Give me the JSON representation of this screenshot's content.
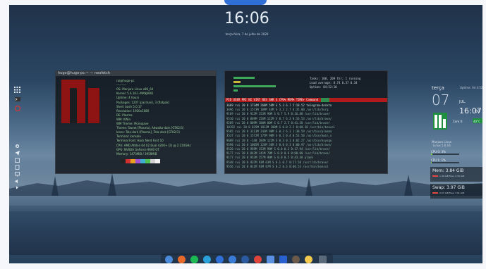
{
  "desktop": {
    "clock_time": "16:06",
    "clock_date": "terça-feira, 7 de julho de 2020"
  },
  "colors": {
    "accent_green": "#1e8f3e",
    "htop_header_red": "#b01c1c",
    "manjaro_green": "#35bf5c",
    "dock_blue": "#2f6fd6"
  },
  "neofetch_window": {
    "title": "hugo@hugo-pc:~ — neofetch",
    "lines": [
      "rui@hugo-pc",
      "----------",
      "OS: Manjaro Linux x86_64",
      "Kernel: 5.6.16-1-MANJARO",
      "Uptime: 4 hours",
      "Packages: 1207 (pacman), 3 (flatpak)",
      "Shell: bash 5.0.17",
      "Resolution: 1920x1080",
      "DE: Plasma",
      "WM: KWin",
      "WM Theme: Mcmojave",
      "Theme: Sweet [Plasma], Adwaita-dark [GTK2/3]",
      "Icons: Tela-dark [Plasma], Tela-dark [GTK2/3]",
      "Terminal: konsole",
      "Terminal Font: Hack Nerd Font 10",
      "CPU: AMD Athlon 64 X2 Dual 4200+ (2) @ 2.210GHz",
      "GPU: NVIDIA GeForce 9600 GT",
      "Memory: 1473MiB / 3958MiB"
    ]
  },
  "htop_window": {
    "header_line": "PID USER      PRI  NI  VIRT   RES   SHR S CPU% MEM%   TIME+  Command",
    "summary_tasks": "Tasks: 108, 209 thr; 1 running",
    "summary_load": "Load average: 0.74 0.37 0.34",
    "summary_uptime": "Uptime: 04:52:10",
    "rows": [
      "3669 rui   20  0  1734M  266M  56M S  5.3  6.7  5:18.52 telegram-deskto",
      "3496 rui   20  0  1573M  109M  44M S  3.3  2.7  6:35.00 /usr/lib/Xorg",
      "9169 rui   20  0   913M  153M  90M S  0.7  5.9  0:16.88 /usr/lib/brave/",
      "9510 rui   20  0   869M  156M 122M S  0.7  6.3  0:16.53 /usr/lib/brave/",
      "9269 rui   20  0   809M  100M  80M S  0.7  2.5  0:41.58 /usr/lib/brave/",
      "10192 rui  20  0   835M 1012M 200M S  0.0  2.2  0:08.38 /usr/bin/konsol",
      "9585 rui   20  0  3113M  243M  90M S  0.3  6.1  1:38.59 /usr/bin/plasma",
      "3537 rui   20  0  1572M  175M  90M S  0.3  0.4  0:53.50 /usr/bin/kwin_x",
      "9609 rui   20  0  -148   284M 122M S  0.3  0.1  0:02.27 /usr/bin/ksysgu",
      "9598 rui   20  0  1005M  124M  36M S  0.0  0.3  0:00.97 /usr/lib/brave/",
      "9520 rui   20  0   969M  153M  90M S  0.0  0.2  0:17.94 /usr/lib/brave/",
      "9177 rui   20  0   843M  141M  70M S  0.0  0.6  0:00.00 /usr/lib/brave/",
      "9177 rui   20  0   953M  157M  90M S  0.0  0.5  0:43.48 plank",
      "9548 rui   20  0   937M   93M  63M S  0.1  0.7  0:17.50 /usr/lib/brave/",
      "9556 rui   20  0   811M   93M  67M S  0.2  0.3  0:00.53 /usr/bin/konsol"
    ]
  },
  "conky": {
    "weekday": "terça",
    "uptime": "Uptime: 0d 4:52",
    "day": "07",
    "month": "JUL.",
    "time": "16:07",
    "seconds": "00",
    "core_label": "Core 0:",
    "core_temp": "40°C",
    "distro": "Manjaro Linux",
    "kernel": "Linux 5.6.16",
    "cpu0": "CPU 0: 3%",
    "cpu1": "CPU 1: 1%",
    "mem_title": "Mem: 3.84 GiB",
    "mem_detail": "1.49 GiB Free: 2.34 GiB",
    "swap_title": "Swap: 3.97 GiB",
    "swap_detail": "0.07 GiB Free: 3.91 GiB"
  },
  "left_dock": {
    "items": [
      "grid-icon",
      "terminal-icon",
      "firefox-icon",
      "settings-icon",
      "telegram-icon",
      "calendar-icon",
      "files-icon",
      "monitor-icon",
      "audio-icon",
      "expand-icon"
    ]
  },
  "bottom_dock": {
    "items": [
      "finder-icon",
      "brave-icon",
      "spotify-icon",
      "telegram-icon",
      "firefox-icon",
      "krita-icon",
      "shutdown-icon",
      "files-icon",
      "music-icon",
      "gimp-icon",
      "notes-icon",
      "terminal-icon"
    ]
  }
}
